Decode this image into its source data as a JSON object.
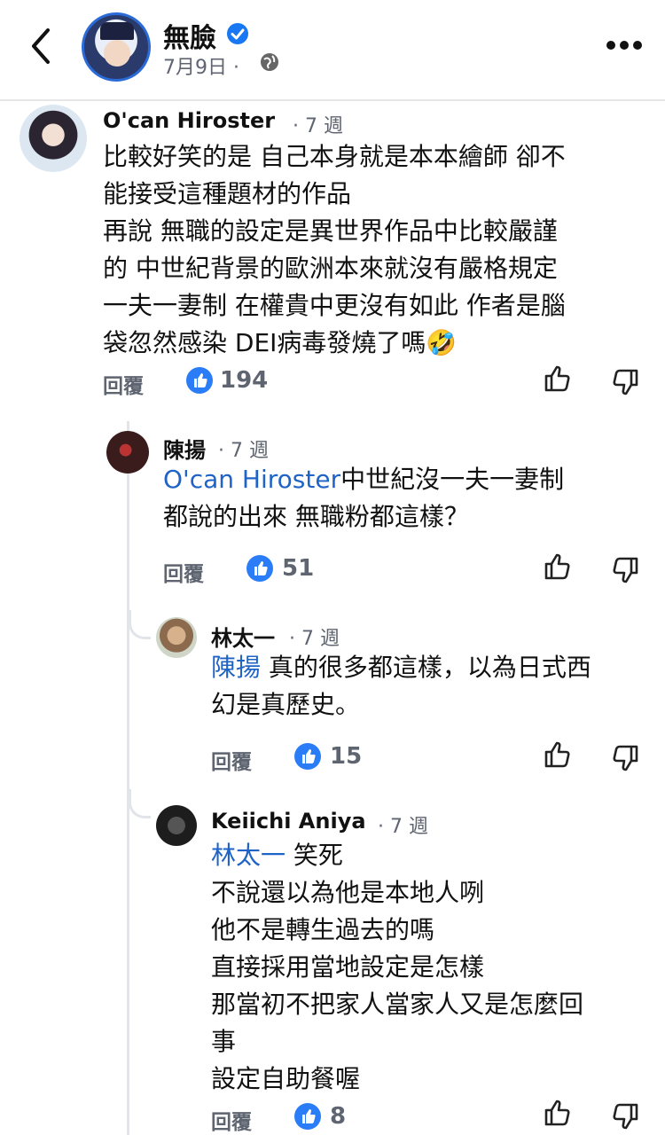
{
  "header": {
    "page_name": "無臉",
    "date": "7月9日",
    "separator": "·"
  },
  "comments": [
    {
      "author": "O'can Hiroster",
      "time": "· 7 週",
      "mention": "",
      "body": "比較好笑的是 自己本身就是本本繪師 卻不\n能接受這種題材的作品\n再說 無職的設定是異世界作品中比較嚴謹\n的 中世紀背景的歐洲本來就沒有嚴格規定\n一夫一妻制 在權貴中更沒有如此 作者是腦\n袋忽然感染 DEI病毒發燒了嗎🤣",
      "reply": "回覆",
      "likes": "194"
    },
    {
      "author": "陳揚",
      "time": "· 7 週",
      "mention": "O'can Hiroster",
      "body": "中世紀沒一夫一妻制\n都說的出來 無職粉都這樣？",
      "reply": "回覆",
      "likes": "51"
    },
    {
      "author": "林太一",
      "time": "· 7 週",
      "mention": "陳揚",
      "body": " 真的很多都這樣，以為日式西\n幻是真歷史。",
      "reply": "回覆",
      "likes": "15"
    },
    {
      "author": "Keiichi Aniya",
      "time": "· 7 週",
      "mention": "林太一",
      "body": " 笑死\n不說還以為他是本地人咧\n他不是轉生過去的嗎\n直接採用當地設定是怎樣\n那當初不把家人當家人又是怎麼回\n事\n設定自助餐喔",
      "reply": "回覆",
      "likes": "8"
    }
  ],
  "colors": {
    "accent": "#1f63c6",
    "like_badge": "#2a7df6",
    "muted_text": "#5f6570"
  },
  "icons": [
    "back-chevron-icon",
    "verified-badge-icon",
    "globe-icon",
    "more-icon",
    "like-icon",
    "dislike-icon"
  ]
}
